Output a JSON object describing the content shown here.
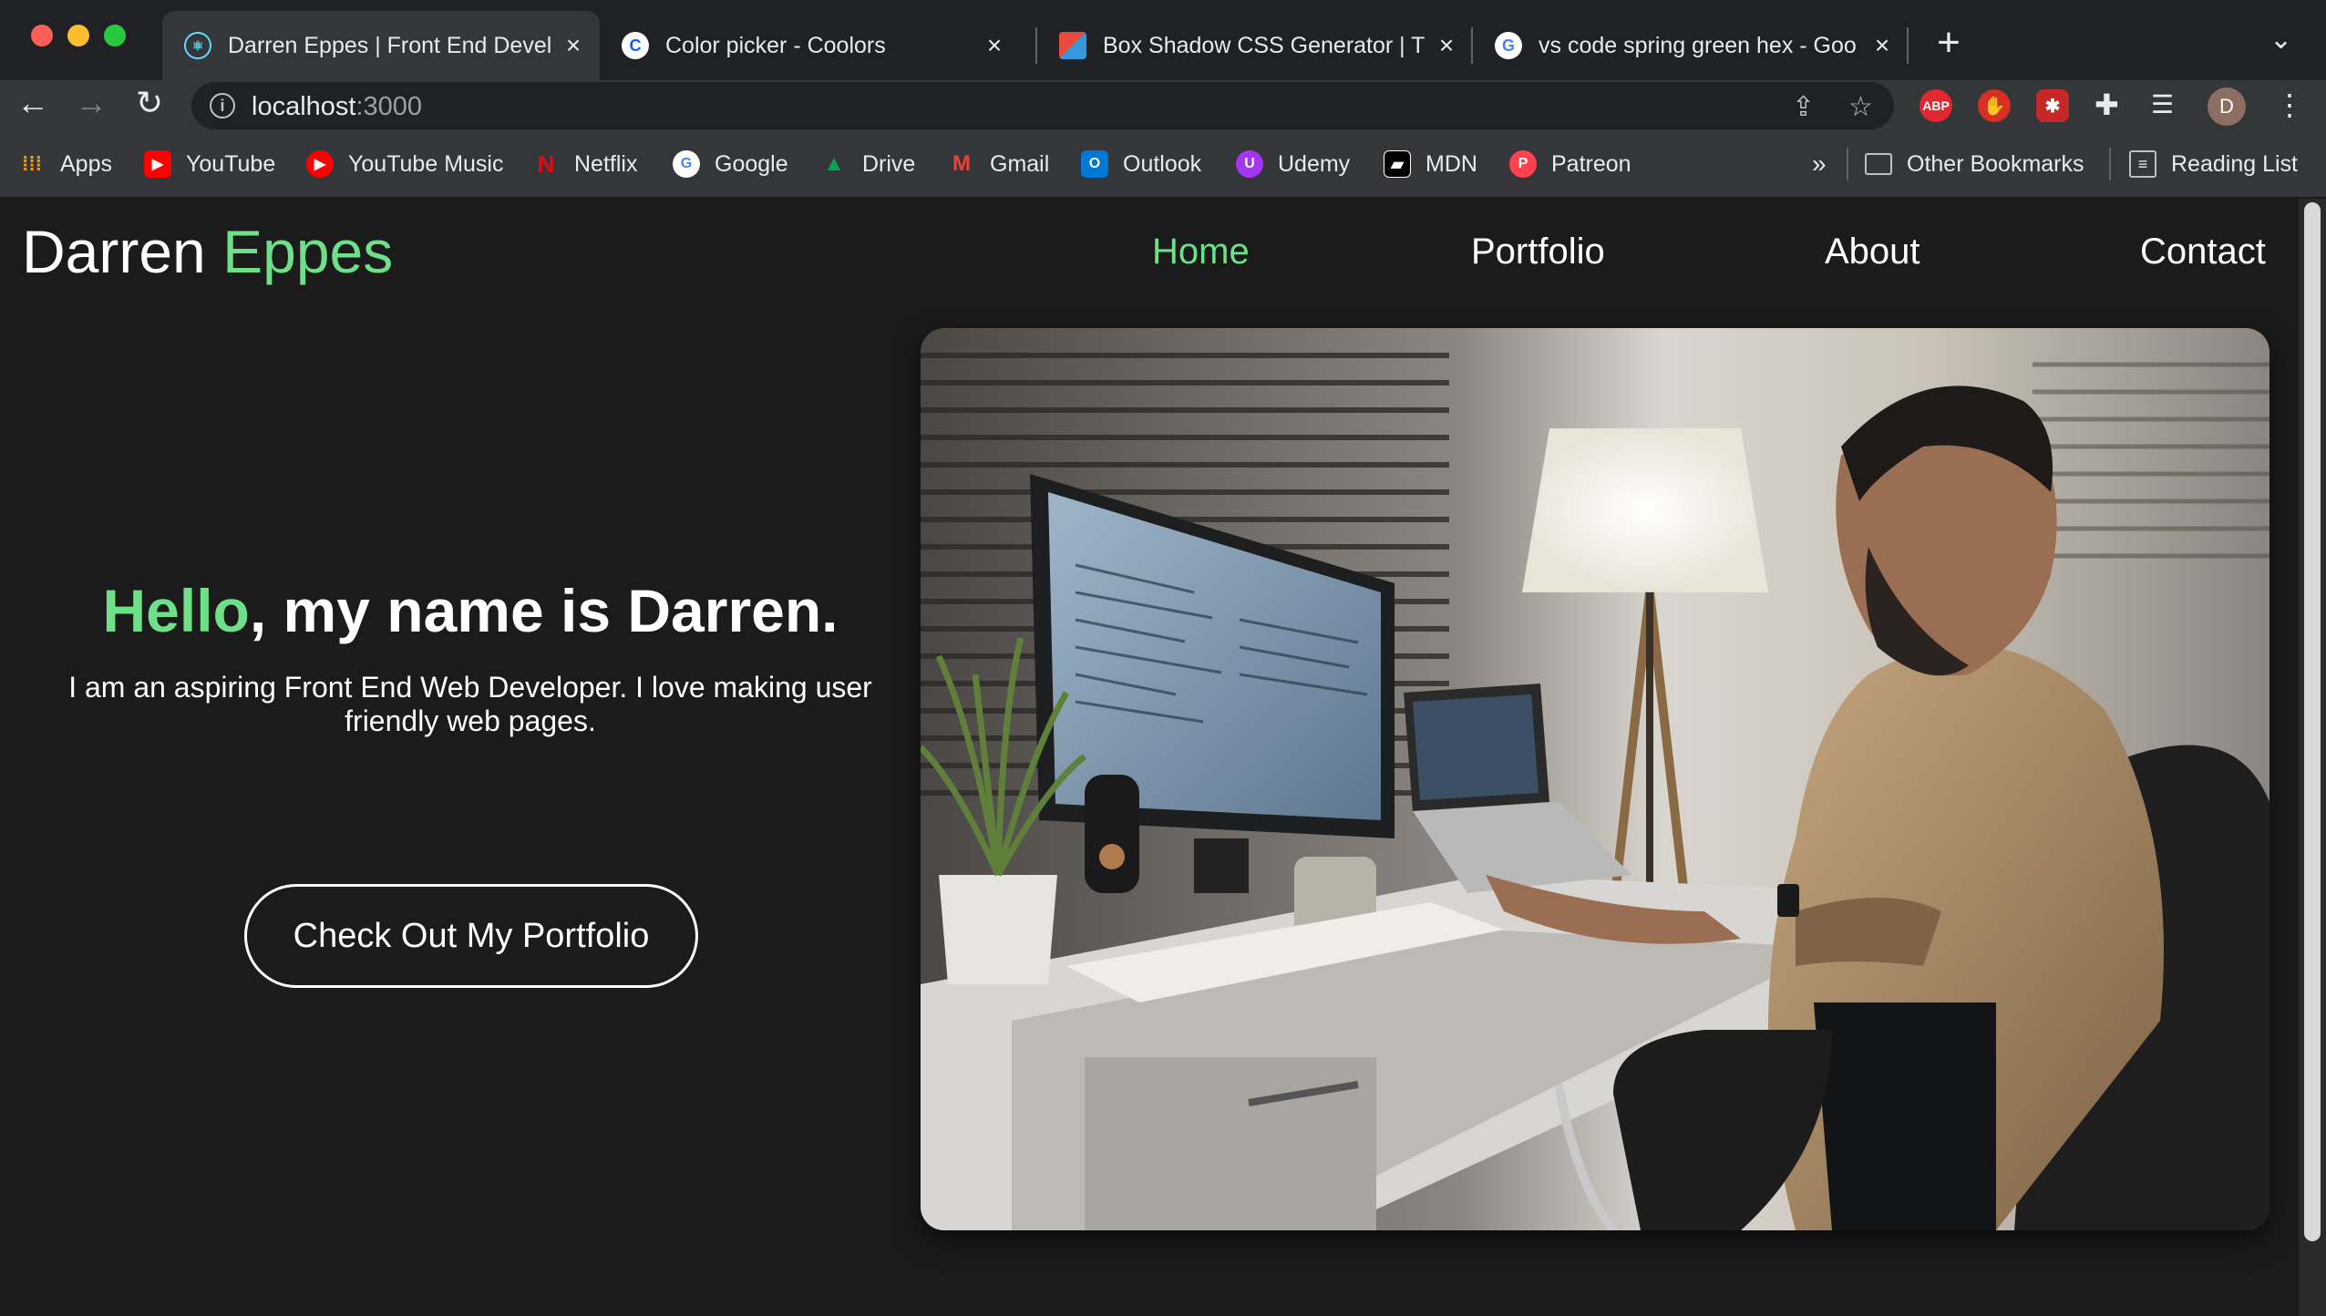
{
  "browser": {
    "tabs": [
      {
        "title": "Darren Eppes | Front End Devel",
        "active": true,
        "favicon": "react-icon"
      },
      {
        "title": "Color picker - Coolors",
        "active": false,
        "favicon": "coolors-icon"
      },
      {
        "title": "Box Shadow CSS Generator | T",
        "active": false,
        "favicon": "cssmatic-icon"
      },
      {
        "title": "vs code spring green hex - Goo",
        "active": false,
        "favicon": "google-icon"
      }
    ],
    "url_host": "localhost",
    "url_port": ":3000",
    "profile_initial": "D",
    "extensions": [
      {
        "name": "adblock-plus-icon",
        "label": "ABP"
      }
    ],
    "bookmarks": [
      {
        "label": "Apps",
        "icon": "apps-grid-icon"
      },
      {
        "label": "YouTube",
        "icon": "youtube-icon"
      },
      {
        "label": "YouTube Music",
        "icon": "youtube-music-icon"
      },
      {
        "label": "Netflix",
        "icon": "netflix-icon"
      },
      {
        "label": "Google",
        "icon": "google-icon"
      },
      {
        "label": "Drive",
        "icon": "drive-icon"
      },
      {
        "label": "Gmail",
        "icon": "gmail-icon"
      },
      {
        "label": "Outlook",
        "icon": "outlook-icon"
      },
      {
        "label": "Udemy",
        "icon": "udemy-icon"
      },
      {
        "label": "MDN",
        "icon": "mdn-icon"
      },
      {
        "label": "Patreon",
        "icon": "patreon-icon"
      }
    ],
    "bookmarks_overflow": "»",
    "other_bookmarks": "Other Bookmarks",
    "reading_list": "Reading List"
  },
  "site": {
    "logo_first": "Darren",
    "logo_second": "Eppes",
    "nav": [
      {
        "label": "Home",
        "active": true
      },
      {
        "label": "Portfolio",
        "active": false
      },
      {
        "label": "About",
        "active": false
      },
      {
        "label": "Contact",
        "active": false
      }
    ],
    "hero": {
      "greeting": "Hello",
      "title_rest": ", my name is Darren.",
      "subtitle": "I am an aspiring Front End Web Developer. I love making user friendly web pages.",
      "cta_label": "Check Out My Portfolio"
    },
    "colors": {
      "accent": "#6ee08a",
      "background": "#1b1b1b",
      "text": "#ffffff"
    }
  }
}
